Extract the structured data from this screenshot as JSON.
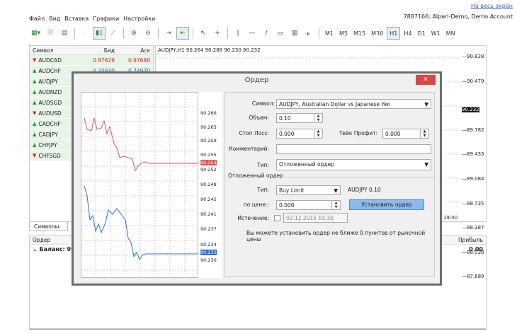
{
  "fullscreen_link": "На весь экран",
  "menu": [
    "Файл",
    "Вид",
    "Вставка",
    "Графики",
    "Настройки"
  ],
  "account": "7887166: Alpari-Demo, Demo Account",
  "toolbar": {
    "timeframes": [
      "M1",
      "M5",
      "M15",
      "M30",
      "H1",
      "H4",
      "D1",
      "W1",
      "MN"
    ],
    "selected_timeframe": "H1"
  },
  "market_watch": {
    "headers": [
      "Символ",
      "Бид",
      "Аск"
    ],
    "rows": [
      {
        "symbol": "AUDCAD",
        "dir": "down",
        "bid": "0.97629",
        "ask": "0.97660"
      },
      {
        "symbol": "AUDCHF",
        "dir": "up",
        "bid": "0.74930",
        "ask": "0.74970"
      },
      {
        "symbol": "AUDJPY",
        "dir": "up",
        "bid": "",
        "ask": ""
      },
      {
        "symbol": "AUDNZD",
        "dir": "up",
        "bid": "",
        "ask": ""
      },
      {
        "symbol": "AUDSGD",
        "dir": "up",
        "bid": "",
        "ask": ""
      },
      {
        "symbol": "AUDUSD",
        "dir": "down",
        "bid": "",
        "ask": ""
      },
      {
        "symbol": "CADCHF",
        "dir": "up",
        "bid": "",
        "ask": ""
      },
      {
        "symbol": "CADJPY",
        "dir": "up",
        "bid": "",
        "ask": ""
      },
      {
        "symbol": "CHFJPY",
        "dir": "up",
        "bid": "",
        "ask": ""
      },
      {
        "symbol": "CHFSGD",
        "dir": "down",
        "bid": "",
        "ask": ""
      }
    ],
    "tab": "Символы"
  },
  "chart": {
    "title": "AUDJPY,H1  90.264 90.288 90.230 90.232",
    "scale": [
      "90.828",
      "90.479",
      "90.232",
      "89.782",
      "89.433",
      "89.084",
      "88.735",
      "88.387",
      "88.038",
      "87.689"
    ],
    "current_price": "90.232",
    "time_label": "19:00",
    "scale_colors": {
      "current": "#1a1a1a"
    }
  },
  "terminal": {
    "col_left": "Ордер",
    "col_right": "Прибыль",
    "balance_label": "Баланс: 99",
    "balance_value": "0.00"
  },
  "dialog": {
    "title": "Ордер",
    "close": "✕",
    "mini_scale": [
      "90.266",
      "90.263",
      "90.259",
      "90.255",
      "90.253",
      "90.252",
      "90.248",
      "90.245",
      "90.241",
      "90.237",
      "90.234",
      "90.232",
      "90.230"
    ],
    "ask_label": "90.253",
    "bid_label": "90.232",
    "colors": {
      "ask": "#e5534b",
      "bid": "#2a6ed6"
    },
    "symbol_label": "Символ:",
    "symbol_value": "AUDJPY, Australian Dollar vs Japanese Yen",
    "volume_label": "Объем:",
    "volume_value": "0.10",
    "sl_label": "Стоп Лосс:",
    "sl_value": "0.000",
    "tp_label": "Тейк Профит:",
    "tp_value": "0.000",
    "comment_label": "Комментарий:",
    "comment_value": "",
    "type_label": "Тип:",
    "type_value": "Отложенный ордер",
    "pending_title": "Отложенный ордер",
    "ptype_label": "Тип:",
    "ptype_value": "Buy Limit",
    "pending_summary": "AUDJPY 0.10",
    "price_label": "по цене::",
    "price_value": "0.000",
    "place_button": "Установить ордер",
    "expiry_label": "Истечение:",
    "expiry_value": "02.12.2015 19:30",
    "note": "Вы можете установить ордер не ближе 0 пунктов от рыночной цены"
  }
}
